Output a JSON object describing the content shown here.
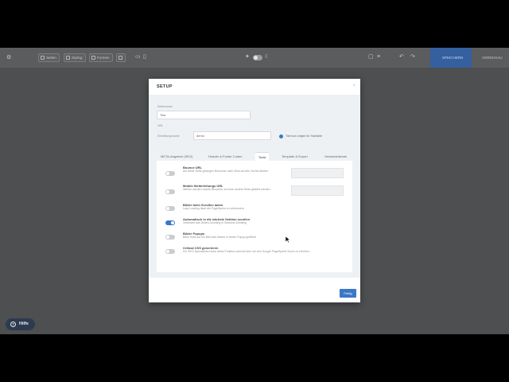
{
  "toolbar": {
    "left_buttons": [
      "Seiten",
      "Styling",
      "Formen"
    ],
    "save_label": "SPEICHERN",
    "publish_label": "VORSCHAU"
  },
  "help": {
    "label": "Hilfe"
  },
  "modal": {
    "title": "SETUP",
    "fields": {
      "name_label": "Seitenname",
      "name_value": "Test",
      "url_label": "URL",
      "url_prefix_label": "Einstellungsname",
      "url_value": "demo",
      "checkbox_label": "Titel Icon zeigen für Startseite"
    },
    "tabs": [
      "META-Angaben (SEO)",
      "Header & Footer Codes",
      "Tools",
      "Template & Export",
      "Versionshistorie"
    ],
    "active_tab": "Tools",
    "rows": [
      {
        "title": "Bounce URL",
        "desc": "Auf diese Seite gelangen Besucher nach Klick auf den Zurück-Button",
        "on": false,
        "has_input": true
      },
      {
        "title": "Mobile Weiterleitungs URL",
        "desc": "Hierhin werden mobile Besucher auf eine andere Seite geleitet werden",
        "on": false,
        "has_input": true
      },
      {
        "title": "Bilder beim Scrollen laden",
        "desc": "Lazy Loading lässt die PageSpeed zu verbessern",
        "on": false,
        "has_input": false
      },
      {
        "title": "Automatisch in die nächste Sektion scrollen",
        "desc": "Verändert das Seiten-Scrolling in Sektions-Scrolling",
        "on": true,
        "has_input": false
      },
      {
        "title": "Bilder Popups",
        "desc": "Beim Klick auf ein Bild wird dieses in einem Popup geöffnet",
        "on": false,
        "has_input": false
      },
      {
        "title": "Critical CSS generieren",
        "desc": "Für SEO-Spezialisten kann diese Funktion sinnvoll sein um den Google PageSpeed Score zu erhöhen",
        "on": false,
        "has_input": false
      }
    ],
    "done_label": "Fertig"
  },
  "colors": {
    "accent": "#3a78c8",
    "toolbar_bg": "#5a5c5e",
    "overlay_bg": "#4d4f51"
  }
}
